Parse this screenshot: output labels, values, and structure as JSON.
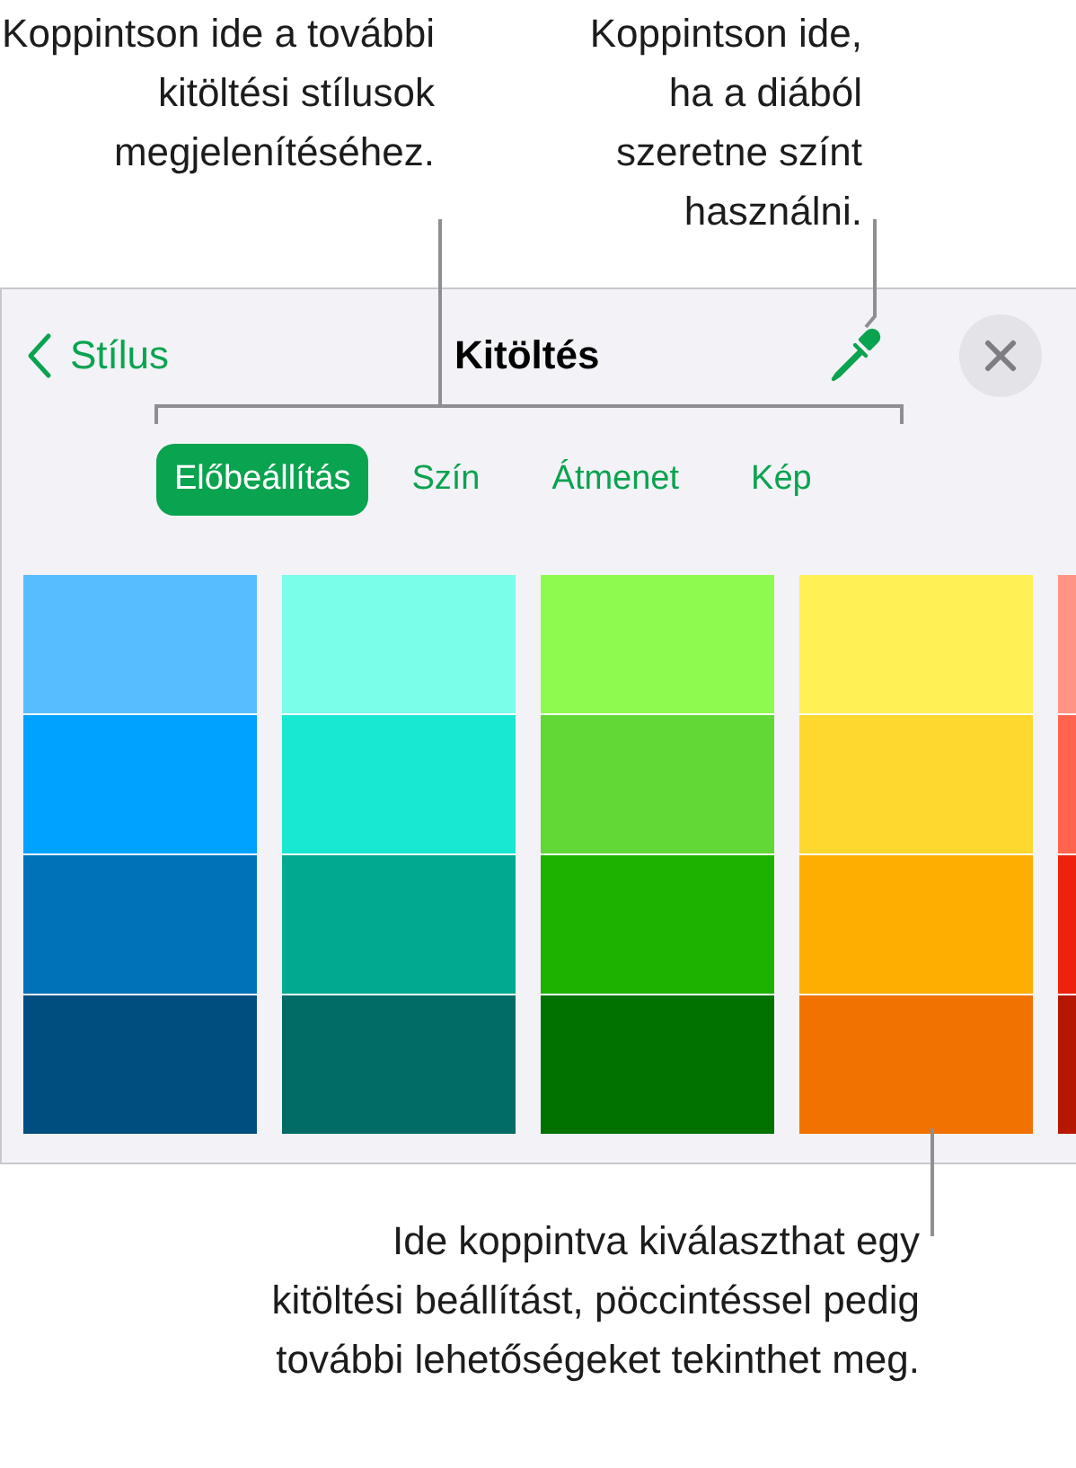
{
  "callouts": [
    {
      "text": "Koppintson ide a további kitöltési stílusok megjelenítéséhez."
    },
    {
      "text": "Koppintson ide, ha a diából szeretne színt használni."
    },
    {
      "text": "Ide koppintva kiválaszthat egy kitöltési beállítást, pöccintéssel pedig további lehetőségeket tekinthet meg."
    }
  ],
  "header": {
    "back": "Stílus",
    "title": "Kitöltés"
  },
  "tabs": [
    {
      "label": "Előbeállítás",
      "selected": true
    },
    {
      "label": "Szín",
      "selected": false
    },
    {
      "label": "Átmenet",
      "selected": false
    },
    {
      "label": "Kép",
      "selected": false
    }
  ],
  "swatch_columns": [
    {
      "swatches": [
        {
          "color": "#57bdff"
        },
        {
          "color": "#00a2ff"
        },
        {
          "color": "#0072b7"
        },
        {
          "color": "#004d80"
        }
      ]
    },
    {
      "swatches": [
        {
          "color": "#7afde9"
        },
        {
          "color": "#18e7d2"
        },
        {
          "color": "#00a98f"
        },
        {
          "color": "#016b66"
        }
      ]
    },
    {
      "swatches": [
        {
          "color": "#8efa4f"
        },
        {
          "color": "#61d836"
        },
        {
          "color": "#1db100"
        },
        {
          "color": "#017100"
        }
      ]
    },
    {
      "swatches": [
        {
          "color": "#fff056"
        },
        {
          "color": "#fed82f"
        },
        {
          "color": "#feae00"
        },
        {
          "color": "#f27200"
        }
      ]
    },
    {
      "swatches": [
        {
          "color": "#ff9484"
        },
        {
          "color": "#ff644e"
        },
        {
          "color": "#ee220c"
        },
        {
          "color": "#b51700"
        }
      ]
    }
  ]
}
